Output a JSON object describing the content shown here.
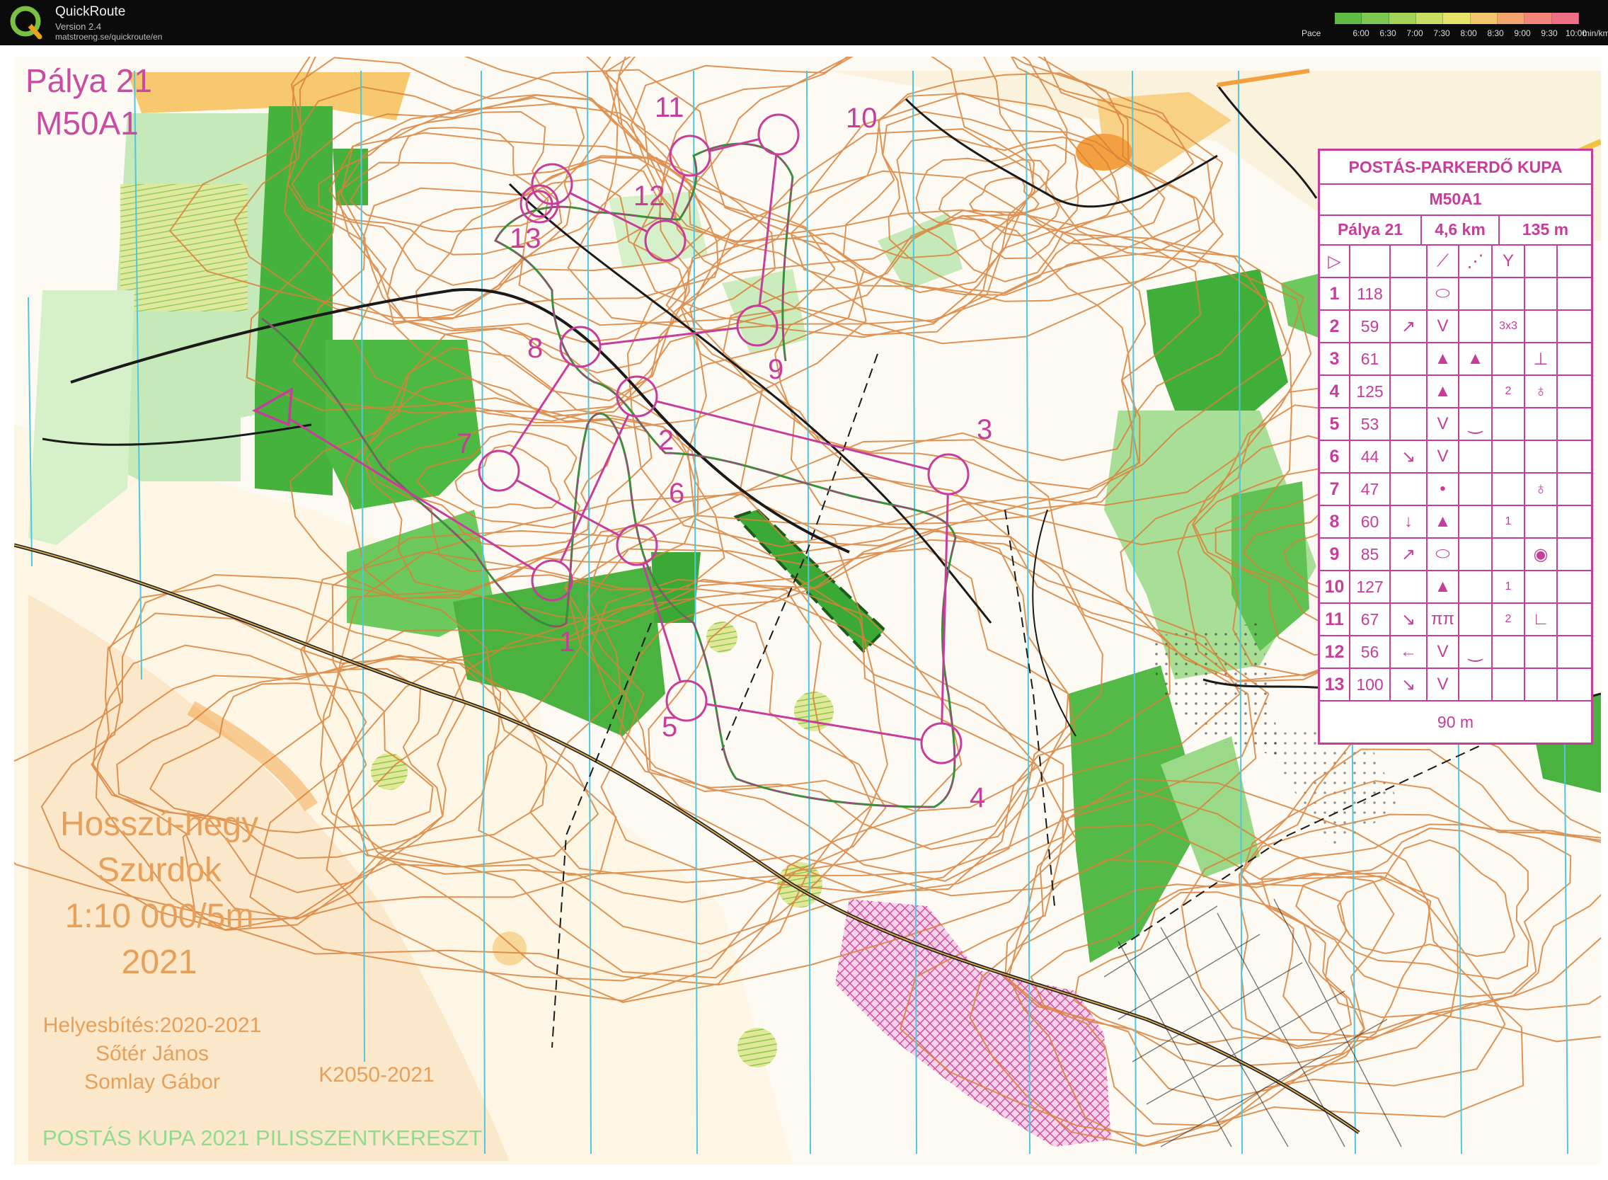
{
  "app": {
    "name": "QuickRoute",
    "version": "Version 2.4",
    "url": "matstroeng.se/quickroute/en"
  },
  "pace_scale": {
    "label": "Pace",
    "ticks": [
      "6:00",
      "6:30",
      "7:00",
      "7:30",
      "8:00",
      "8:30",
      "9:00",
      "9:30",
      "10:00"
    ],
    "unit": "min/km",
    "colors": [
      "#5dbb46",
      "#7ec850",
      "#a4d35a",
      "#c9dd63",
      "#e6e26a",
      "#f1c36b",
      "#f2a46e",
      "#f2857a",
      "#ee6f86"
    ]
  },
  "map": {
    "course_title": "Pálya 21",
    "category": "M50A1",
    "area_name_line1": "Hosszú-hegy",
    "area_name_line2": "Szurdok",
    "scale": "1:10 000/5m",
    "year": "2021",
    "update_line": "Helyesbítés:2020-2021",
    "author1": "Sőtér János",
    "author2": "Somlay Gábor",
    "permit": "K2050-2021",
    "footer": "POSTÁS KUPA 2021 PILISSZENTKERESZT",
    "control_labels": [
      "1",
      "2",
      "3",
      "4",
      "5",
      "6",
      "7",
      "8",
      "9",
      "10",
      "11",
      "12",
      "13"
    ],
    "colors": {
      "course": "#c63d9a",
      "forest": "#3aaa35",
      "light_forest": "#b5e3a5",
      "open": "#f7c86e",
      "contour": "#d9823a"
    }
  },
  "legend": {
    "event": "POSTÁS-PARKERDŐ KUPA",
    "category": "M50A1",
    "course": "Pálya 21",
    "length": "4,6 km",
    "climb": "135 m",
    "finish_distance": "90 m",
    "controls": [
      {
        "num": "1",
        "code": "118",
        "dir": "",
        "c1": "⬭",
        "c2": "",
        "dim": "",
        "pos": ""
      },
      {
        "num": "2",
        "code": "59",
        "dir": "↗",
        "c1": "V",
        "c2": "",
        "dim": "3x3",
        "pos": ""
      },
      {
        "num": "3",
        "code": "61",
        "dir": "",
        "c1": "▲",
        "c2": "▲",
        "dim": "",
        "pos": "⊥"
      },
      {
        "num": "4",
        "code": "125",
        "dir": "",
        "c1": "▲",
        "c2": "",
        "dim": "2",
        "pos": "♁"
      },
      {
        "num": "5",
        "code": "53",
        "dir": "",
        "c1": "V",
        "c2": "‿",
        "dim": "",
        "pos": ""
      },
      {
        "num": "6",
        "code": "44",
        "dir": "↘",
        "c1": "V",
        "c2": "",
        "dim": "",
        "pos": ""
      },
      {
        "num": "7",
        "code": "47",
        "dir": "",
        "c1": "•",
        "c2": "",
        "dim": "",
        "pos": "♁"
      },
      {
        "num": "8",
        "code": "60",
        "dir": "↓",
        "c1": "▲",
        "c2": "",
        "dim": "1",
        "pos": ""
      },
      {
        "num": "9",
        "code": "85",
        "dir": "↗",
        "c1": "⬭",
        "c2": "",
        "dim": "",
        "pos": "◉"
      },
      {
        "num": "10",
        "code": "127",
        "dir": "",
        "c1": "▲",
        "c2": "",
        "dim": "1",
        "pos": ""
      },
      {
        "num": "11",
        "code": "67",
        "dir": "↘",
        "c1": "ππ",
        "c2": "",
        "dim": "2",
        "pos": "∟"
      },
      {
        "num": "12",
        "code": "56",
        "dir": "←",
        "c1": "V",
        "c2": "‿",
        "dim": "",
        "pos": ""
      },
      {
        "num": "13",
        "code": "100",
        "dir": "↘",
        "c1": "V",
        "c2": "",
        "dim": "",
        "pos": ""
      }
    ]
  }
}
